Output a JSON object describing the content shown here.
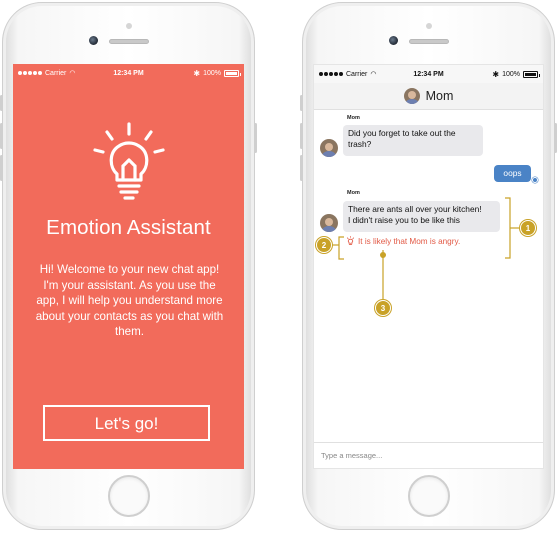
{
  "status_bar": {
    "carrier": "Carrier",
    "time": "12:34 PM",
    "battery": "100%"
  },
  "welcome_screen": {
    "title": "Emotion Assistant",
    "message": "Hi! Welcome to your new chat app! I'm your assistant. As you use the app, I will help you understand more about your contacts as you chat with them.",
    "button_label": "Let's go!",
    "background_color": "#f26b5b",
    "icon": "lightbulb-icon"
  },
  "chat_screen": {
    "contact_name": "Mom",
    "messages": [
      {
        "sender": "Mom",
        "direction": "incoming",
        "text_lines": [
          "Did you forget to take out the",
          "trash?"
        ]
      },
      {
        "sender": "",
        "direction": "outgoing",
        "text_lines": [
          "oops"
        ]
      },
      {
        "sender": "Mom",
        "direction": "incoming",
        "text_lines": [
          "There are ants all over your kitchen!",
          "I didn't raise you to be like this"
        ]
      }
    ],
    "emotion_hint": "It is likely that Mom is angry.",
    "input_placeholder": "Type a message...",
    "accent_color": "#4a83c6",
    "hint_color": "#e25a46"
  },
  "annotations": {
    "labels": [
      "1",
      "2",
      "3"
    ],
    "color": "#c9a227"
  }
}
